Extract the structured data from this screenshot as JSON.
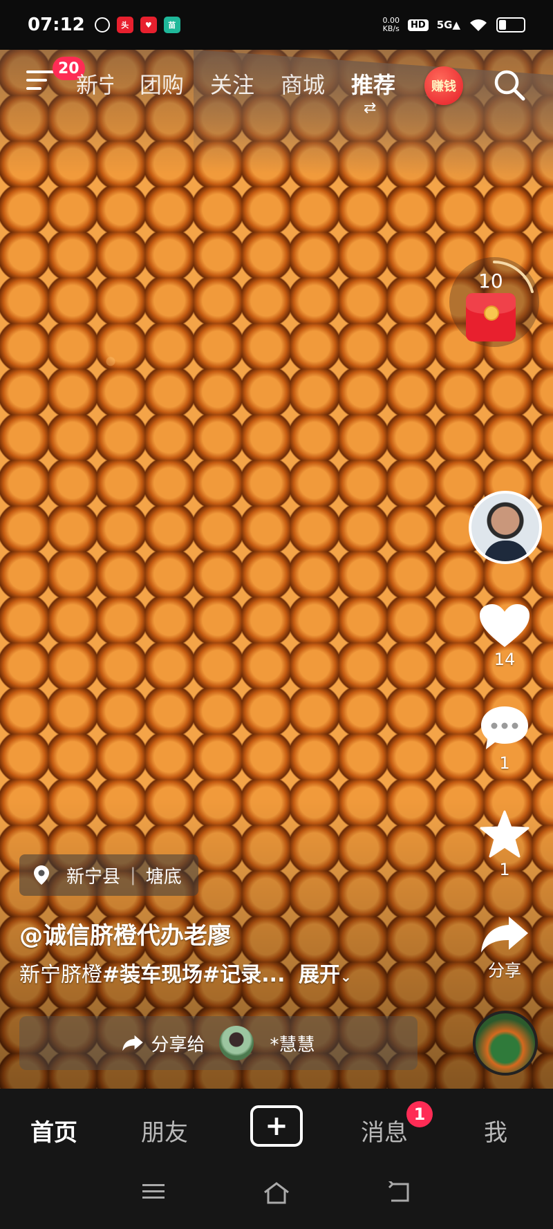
{
  "status_bar": {
    "time": "07:12",
    "notification_icons": [
      "app-icon-1",
      "toutiao-icon",
      "app-icon-3",
      "app-icon-4"
    ],
    "net_speed_value": "0.00",
    "net_speed_unit": "KB/s",
    "hd_label": "HD",
    "signal_label": "5G",
    "battery_level": 0.3
  },
  "top_nav": {
    "menu_badge": "20",
    "tabs": [
      "新宁",
      "团购",
      "关注",
      "商城",
      "推荐"
    ],
    "active_tab": "推荐",
    "earn_label": "赚钱"
  },
  "red_packet": {
    "count": "10"
  },
  "actions": {
    "like_count": "14",
    "comment_count": "1",
    "favorite_count": "1",
    "share_label": "分享"
  },
  "video_info": {
    "location_county": "新宁县",
    "location_place": "塘底",
    "author": "@诚信脐橙代办老廖",
    "description_prefix": "新宁脐橙",
    "hashtag_1": "#装车现场",
    "hashtag_2": "#记录...",
    "expand_label": "展开"
  },
  "share_bar": {
    "label": "分享给",
    "friend_name": "*慧慧"
  },
  "bottom_tabs": {
    "home": "首页",
    "friends": "朋友",
    "messages": "消息",
    "messages_badge": "1",
    "me": "我"
  },
  "colors": {
    "badge": "#fe2c55",
    "tab_bar_bg": "#161616"
  }
}
